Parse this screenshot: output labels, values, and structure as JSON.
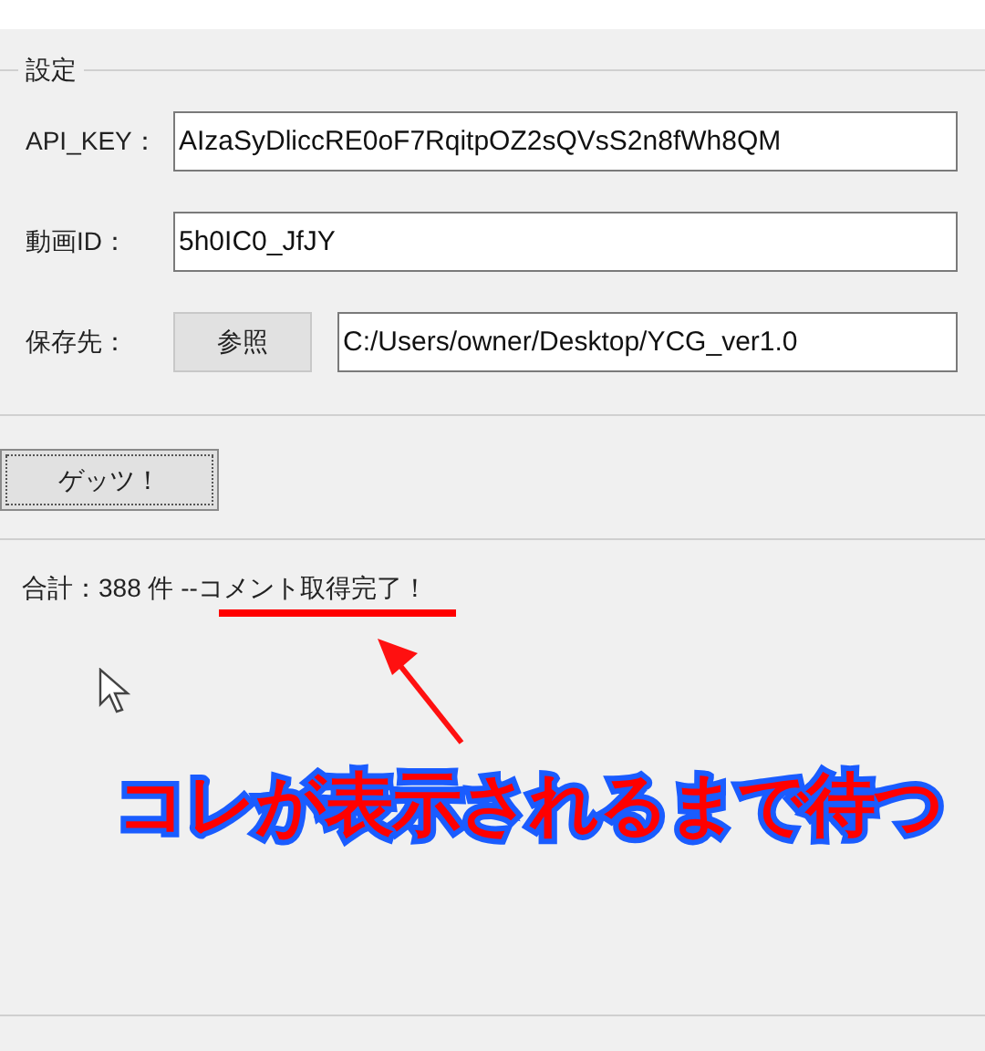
{
  "group": {
    "title": "設定"
  },
  "fields": [
    {
      "kind": "text",
      "label": "API_KEY：",
      "value": "AIzaSyDliccRE0oF7RqitpOZ2sQVsS2n8fWh8QM"
    },
    {
      "kind": "text",
      "label": "動画ID：",
      "value": "5h0IC0_JfJY"
    },
    {
      "kind": "browse",
      "label": "保存先：",
      "button": "参照",
      "value": "C:/Users/owner/Desktop/YCG_ver1.0"
    }
  ],
  "get_button": "ゲッツ！",
  "output": {
    "text": "合計：388 件 --コメント取得完了！"
  },
  "annotation": {
    "text": "コレが表示されるまで待つ"
  }
}
